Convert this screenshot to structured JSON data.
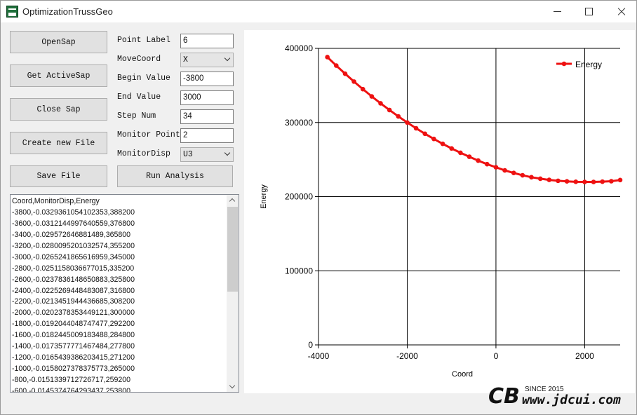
{
  "window": {
    "title": "OptimizationTrussGeo",
    "min_glyph": "—",
    "max_glyph": "☐",
    "close_glyph": "✕"
  },
  "buttons": {
    "open_sap": "OpenSap",
    "get_active_sap": "Get ActiveSap",
    "close_sap": "Close Sap",
    "create_new_file": "Create new File",
    "save_file": "Save File",
    "run_analysis": "Run Analysis"
  },
  "form": {
    "point_label": {
      "label": "Point Label",
      "value": "6"
    },
    "move_coord": {
      "label": "MoveCoord",
      "value": "X"
    },
    "begin_value": {
      "label": "Begin Value",
      "value": "-3800"
    },
    "end_value": {
      "label": "End Value",
      "value": "3000"
    },
    "step_num": {
      "label": "Step Num",
      "value": "34"
    },
    "monitor_point": {
      "label": "Monitor Point",
      "value": "2"
    },
    "monitor_disp": {
      "label": "MonitorDisp",
      "value": "U3"
    }
  },
  "output": {
    "lines": [
      "Coord,MonitorDisp,Energy",
      "-3800,-0.0329361054102353,388200",
      "-3600,-0.0312144997640559,376800",
      "-3400,-0.029572646881489,365800",
      "-3200,-0.0280095201032574,355200",
      "-3000,-0.0265241865616959,345000",
      "-2800,-0.0251158036677015,335200",
      "-2600,-0.0237836148650883,325800",
      "-2400,-0.0225269448483087,316800",
      "-2200,-0.0213451944436685,308200",
      "-2000,-0.0202378353449121,300000",
      "-1800,-0.0192044048747477,292200",
      "-1600,-0.0182445009183488,284800",
      "-1400,-0.0173577771467484,277800",
      "-1200,-0.0165439386203415,271200",
      "-1000,-0.0158027378375773,265000",
      "-800,-0.0151339712726717,259200",
      "-600,-0.0145374764293437,253800"
    ]
  },
  "chart_data": {
    "type": "line",
    "title": "",
    "xlabel": "Coord",
    "ylabel": "Energy",
    "xlim": [
      -4000,
      2800
    ],
    "ylim": [
      0,
      400000
    ],
    "x_ticks": [
      "-4000",
      "-2000",
      "0",
      "2000"
    ],
    "y_ticks": [
      "0",
      "100000",
      "200000",
      "300000",
      "400000"
    ],
    "x_tick_values": [
      -4000,
      -2000,
      0,
      2000
    ],
    "y_tick_values": [
      0,
      100000,
      200000,
      300000,
      400000
    ],
    "grid": true,
    "legend_position": "top-right",
    "series": [
      {
        "name": "Energy",
        "color": "#ee1111",
        "x": [
          -3800,
          -3600,
          -3400,
          -3200,
          -3000,
          -2800,
          -2600,
          -2400,
          -2200,
          -2000,
          -1800,
          -1600,
          -1400,
          -1200,
          -1000,
          -800,
          -600,
          -400,
          -200,
          0,
          200,
          400,
          600,
          800,
          1000,
          1200,
          1400,
          1600,
          1800,
          2000,
          2200,
          2400,
          2600,
          2800
        ],
        "values": [
          388200,
          376800,
          365800,
          355200,
          345000,
          335200,
          325800,
          316800,
          308200,
          300000,
          292200,
          284800,
          277800,
          271200,
          265000,
          259200,
          253800,
          248600,
          243800,
          239600,
          235400,
          232000,
          228800,
          226200,
          224200,
          222600,
          221400,
          220600,
          220000,
          219800,
          219800,
          220200,
          220800,
          222400
        ]
      }
    ]
  },
  "watermark": {
    "logo": "CB",
    "since": "SINCE 2015",
    "url": "www.jdcui.com"
  }
}
